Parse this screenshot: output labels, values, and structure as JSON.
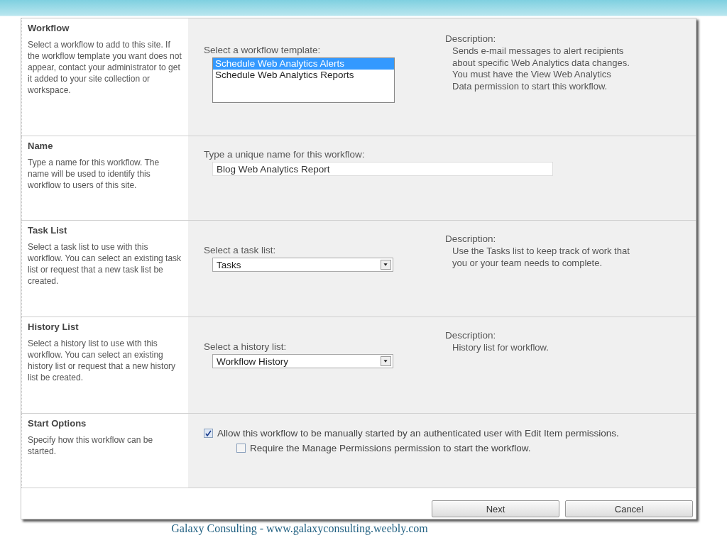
{
  "sections": [
    {
      "kind": "listbox",
      "title": "Workflow",
      "help": "Select a workflow to add to this site. If the workflow template you want does not appear, contact your administrator to get it added to your site collection or workspace.",
      "label": "Select a workflow template:",
      "options": [
        {
          "label": "Schedule Web Analytics Alerts",
          "selected": true
        },
        {
          "label": "Schedule Web Analytics Reports",
          "selected": false
        }
      ],
      "description_label": "Description:",
      "description": "Sends e-mail messages to alert recipients about specific Web Analytics data changes. You must have the View Web Analytics Data permission to start this workflow."
    },
    {
      "kind": "text",
      "title": "Name",
      "help": "Type a name for this workflow. The name will be used to identify this workflow to users of this site.",
      "label": "Type a unique name for this workflow:",
      "value": "Blog Web Analytics Report"
    },
    {
      "kind": "select",
      "title": "Task List",
      "help": "Select a task list to use with this workflow. You can select an existing task list or request that a new task list be created.",
      "label": "Select a task list:",
      "value": "Tasks",
      "description_label": "Description:",
      "description": "Use the Tasks list to keep track of work that you or your team needs to complete."
    },
    {
      "kind": "select",
      "title": "History List",
      "help": "Select a history list to use with this workflow. You can select an existing history list or request that a new history list be created.",
      "label": "Select a history list:",
      "value": "Workflow History",
      "description_label": "Description:",
      "description": "History list for workflow."
    },
    {
      "kind": "checkboxes",
      "title": "Start Options",
      "help": "Specify how this workflow can be started.",
      "options": [
        {
          "label": "Allow this workflow to be manually started by an authenticated user with Edit Item permissions.",
          "checked": true
        },
        {
          "label": "Require the Manage Permissions permission to start the workflow.",
          "checked": false
        }
      ]
    }
  ],
  "buttons": [
    "Next",
    "Cancel"
  ],
  "footer": "Galaxy Consulting - www.galaxyconsulting.weebly.com"
}
